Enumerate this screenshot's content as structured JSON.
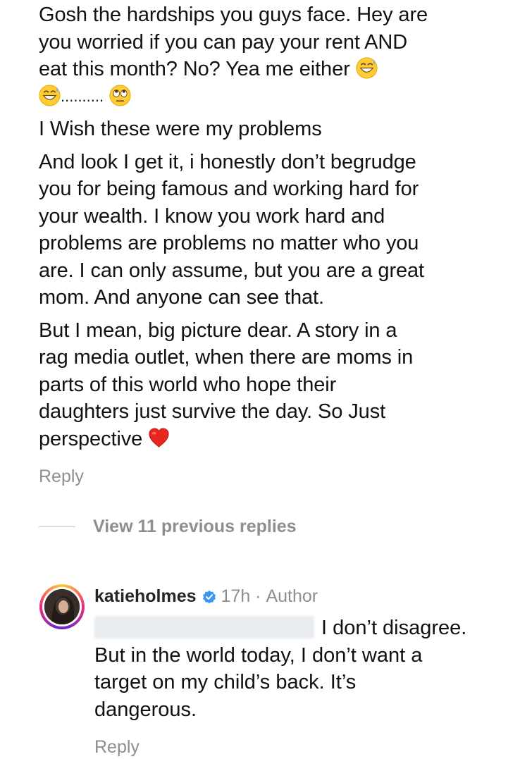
{
  "comment": {
    "paragraph_1": {
      "line_1": "Gosh the hardships you guys face. Hey are",
      "line_2": "you worried if you can pay your rent AND",
      "line_3": "eat this month?  No? Yea me either",
      "dots": ".........."
    },
    "paragraph_2": "I Wish these were my problems",
    "paragraph_3": [
      "And look I get it, i honestly don’t begrudge",
      "you for being famous and working hard for",
      "your wealth. I know you work hard and",
      "problems are problems no matter who you",
      "are. I can only assume,  but you are a great",
      "mom. And anyone can see that."
    ],
    "paragraph_4": [
      "But I mean, big picture dear.  A story in a",
      "rag media outlet, when there are moms in",
      "parts of this world who hope their",
      "daughters just survive the day. So Just",
      "perspective"
    ],
    "reply_label": "Reply",
    "emojis": [
      "grinning-sweat-emoji",
      "grinning-sweat-emoji",
      "rolling-eyes-emoji",
      "red-heart-emoji"
    ]
  },
  "view_replies": {
    "label": "View 11 previous replies"
  },
  "author_reply": {
    "username": "katieholmes",
    "time": "17h",
    "separator": " · ",
    "badge": "Author",
    "text_line_1": "I don’t disagree.",
    "text_lines": [
      "But in the world today, I don’t want a",
      "target on my child’s back. It’s",
      "dangerous."
    ],
    "reply_label": "Reply",
    "verified_color": "#3897f0"
  }
}
